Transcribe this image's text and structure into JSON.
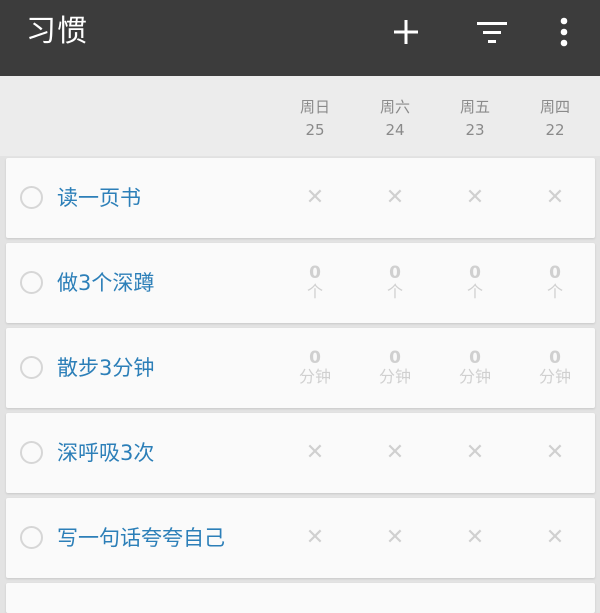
{
  "appbar": {
    "title": "习惯",
    "add_icon": "plus-icon",
    "filter_icon": "filter-icon",
    "more_icon": "more-vert-icon"
  },
  "days": [
    {
      "weekday": "周日",
      "date": "25"
    },
    {
      "weekday": "周六",
      "date": "24"
    },
    {
      "weekday": "周五",
      "date": "23"
    },
    {
      "weekday": "周四",
      "date": "22"
    }
  ],
  "habits": [
    {
      "name": "读一页书",
      "kind": "check",
      "marks": [
        "✕",
        "✕",
        "✕",
        "✕"
      ]
    },
    {
      "name": "做3个深蹲",
      "kind": "count",
      "values": [
        "0",
        "0",
        "0",
        "0"
      ],
      "unit": "个"
    },
    {
      "name": "散步3分钟",
      "kind": "count",
      "values": [
        "0",
        "0",
        "0",
        "0"
      ],
      "unit": "分钟"
    },
    {
      "name": "深呼吸3次",
      "kind": "check",
      "marks": [
        "✕",
        "✕",
        "✕",
        "✕"
      ]
    },
    {
      "name": "写一句话夸夸自己",
      "kind": "check",
      "marks": [
        "✕",
        "✕",
        "✕",
        "✕"
      ]
    }
  ],
  "colors": {
    "appbar": "#3c3c3c",
    "habit_name": "#2c7fb8",
    "inactive": "#d0d0d0"
  }
}
